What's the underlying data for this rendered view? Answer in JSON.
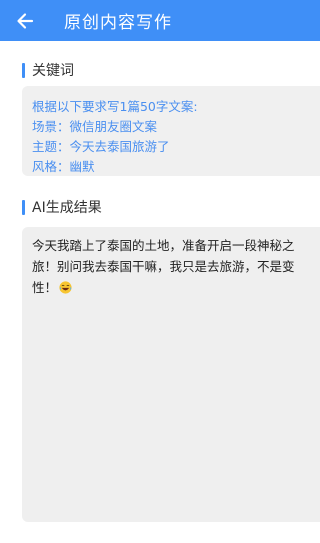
{
  "header": {
    "title": "原创内容写作"
  },
  "keywords": {
    "label": "关键词",
    "lines": [
      "根据以下要求写1篇50字文案:",
      "场景：微信朋友圈文案",
      "主题：今天去泰国旅游了",
      "风格：幽默"
    ]
  },
  "result": {
    "label": "AI生成结果",
    "text": "今天我踏上了泰国的土地，准备开启一段神秘之旅！别问我去泰国干嘛，我只是去旅游，不是变性！",
    "emoji": "laughing-emoji-icon"
  },
  "colors": {
    "accent": "#3f8ff7",
    "keyword_text": "#4a8ff0",
    "box_bg": "#f0f0f0"
  }
}
